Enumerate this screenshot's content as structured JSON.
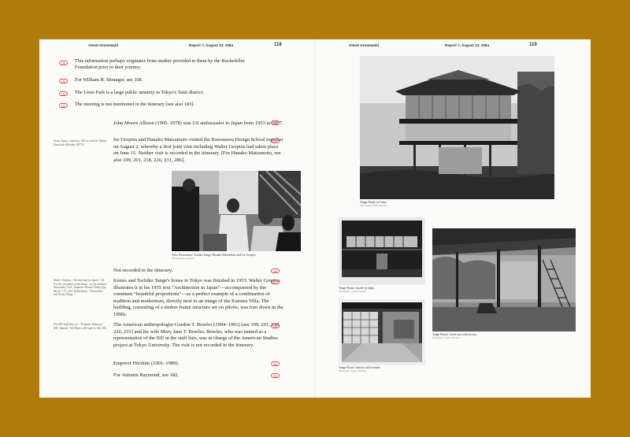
{
  "left_page": {
    "running_author": "Almut Grunewald",
    "running_title": "Report 7, August 23, 1954",
    "page_number": "118",
    "footnotes": [
      {
        "num": "230",
        "text": "This information perhaps originates from studies provided to them by the Rockefeller Foundation prior to their journey."
      },
      {
        "num": "231",
        "text": "For William H. Shrauger, see 168."
      },
      {
        "num": "232",
        "text": "The Ueno Park is a large public amenity in Tokyo's Taitō district."
      },
      {
        "num": "233",
        "text": "The meeting is not mentioned in the itinerary [see also 183]."
      }
    ],
    "paragraphs": [
      {
        "num": "234",
        "text": "John Moore Allison (1905–1978) was US ambassador to Japan from 1953 to 1957."
      },
      {
        "num": "235",
        "text": "Ise Gropius and Hanako Matsumoto visited the Kuwasawa Design School together on August 2, whereby a first joint visit including Walter Gropius had taken place on June 15. Neither visit is recorded in the itinerary. [For Hanako Matsumoto, see also 199, 201, 218, 226, 231, 286]."
      },
      {
        "num": "236",
        "text": "Not recorded in the itinerary."
      },
      {
        "num": "237",
        "text": "Kenzo and Tochiko Tange's house in Tokyo was finished in 1953. Walter Gropius illustrates it in his 1955 text “Architecture in Japan”—accompanied by the comment “beautiful proportions”—as a perfect example of a combination of tradition and modernism, directly next to an image of the Katsura Villa. The building, consisting of a timber-frame structure set on pilotis, was torn down in the 1990s."
      },
      {
        "num": "238",
        "text": "The American anthropologist Gordon T. Bowles (1904–1991) [see 199, 201, 218, 226, 231] and his wife Mary Jane T. Bowles. Bowles, who was named as a representative of the IHJ in the staff lists, was in charge of the American Studies project at Tokyo University. The visit is not recorded in the itinerary."
      },
      {
        "num": "239",
        "text": "Emperor Hirohito (1901–1989)."
      },
      {
        "num": "240",
        "text": "For Antonin Raymond, see 182."
      }
    ],
    "sidenotes": [
      "Sawa, Inoue e tsuiseru, 145, as cited in Takagi, Yamawaki Michiko, 907–8.",
      "Walter Gropius, “Architecture in Japan,” 24. For the reception of the house, see for instance Yamawaki, et al., Japanese Houses Today, figs. 66, 67, 173, 200; Kullermann, “Walterhaus von Kenzo Tange.”",
      "For IHJ staff lists, see “Tentative Itinerary,” IHJ; Takeshi, Toll Planet, 201 and 2c, 40, 272."
    ],
    "photo_caption": "Yoko Kawamura, Toshiko Tange, Hanako Matsumoto and Ise Gropius",
    "photo_credit": "Photographer unknown"
  },
  "right_page": {
    "running_author": "Almut Grunewald",
    "running_title": "Report 7, August 23, 1954",
    "page_number": "119",
    "photos": [
      {
        "caption": "Tange House in Tokyo",
        "credit": "Photograph Yoshio Shiratori"
      },
      {
        "caption": "Tange House: facade by night",
        "credit": "Photograph Yoshio Shiratori"
      },
      {
        "caption": "Tange House: interior and veranda",
        "credit": "Photograph Yoshio Shiratori"
      },
      {
        "caption": "Tange House: lower area with access",
        "credit": "Photograph Yoshio Shiratori"
      }
    ]
  }
}
